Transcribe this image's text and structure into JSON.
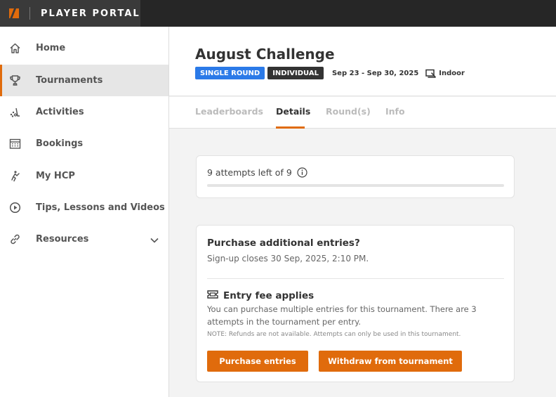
{
  "brand": {
    "title": "PLAYER PORTAL",
    "logo_icon": "portal-logo-icon"
  },
  "sidebar": {
    "items": [
      {
        "label": "Home",
        "icon": "home-icon",
        "active": false
      },
      {
        "label": "Tournaments",
        "icon": "trophy-icon",
        "active": true
      },
      {
        "label": "Activities",
        "icon": "activities-icon",
        "active": false
      },
      {
        "label": "Bookings",
        "icon": "calendar-icon",
        "active": false
      },
      {
        "label": "My HCP",
        "icon": "golfer-icon",
        "active": false
      },
      {
        "label": "Tips, Lessons and Videos",
        "icon": "play-circle-icon",
        "active": false
      },
      {
        "label": "Resources",
        "icon": "link-icon",
        "active": false,
        "expandable": true
      }
    ]
  },
  "tournament": {
    "title": "August Challenge",
    "badges": [
      "SINGLE ROUND",
      "INDIVIDUAL"
    ],
    "dates": "Sep 23 - Sep 30, 2025",
    "venue": "Indoor"
  },
  "tabs": [
    {
      "label": "Leaderboards",
      "active": false
    },
    {
      "label": "Details",
      "active": true
    },
    {
      "label": "Round(s)",
      "active": false
    },
    {
      "label": "Info",
      "active": false
    }
  ],
  "attempts": {
    "text": "9 attempts left of 9",
    "used_fraction": 0
  },
  "purchase": {
    "title": "Purchase additional entries?",
    "signup_closes": "Sign-up closes 30 Sep, 2025, 2:10 PM.",
    "fee_title": "Entry fee applies",
    "fee_desc": "You can purchase multiple entries for this tournament. There are 3 attempts in the tournament per entry.",
    "note": "NOTE: Refunds are not available. Attempts can only be used in this tournament.",
    "buttons": {
      "purchase": "Purchase entries",
      "withdraw": "Withdraw from tournament"
    }
  },
  "colors": {
    "accent": "#e06b0c",
    "badge_blue": "#2b7ae8",
    "badge_dark": "#333333",
    "topbar": "#262626"
  }
}
